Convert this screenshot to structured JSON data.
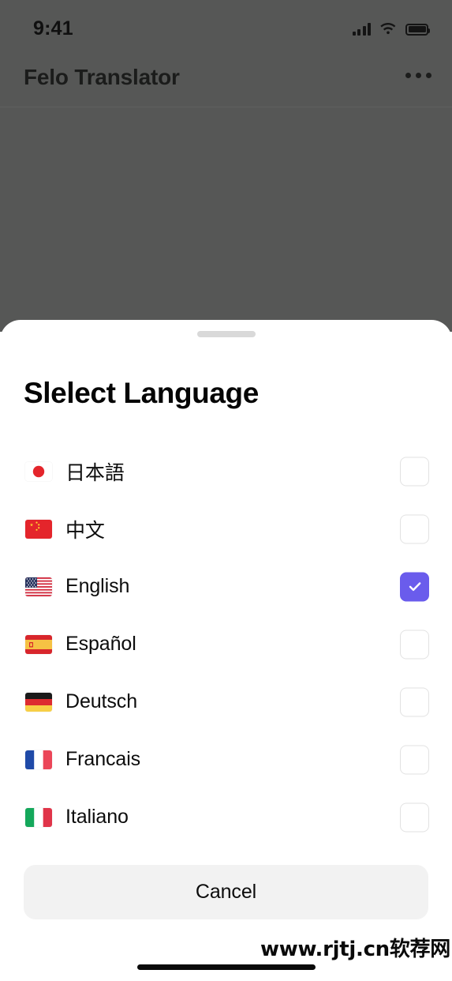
{
  "status_bar": {
    "time": "9:41",
    "icons": [
      "cellular-signal-icon",
      "wifi-icon",
      "battery-icon"
    ]
  },
  "app_bar": {
    "title": "Felo Translator",
    "overflow_icon": "more-horizontal-icon"
  },
  "sheet": {
    "handle": "drag-handle",
    "title": "Slelect Language",
    "cancel_label": "Cancel",
    "languages": [
      {
        "label": "日本語",
        "flag": "flag-japan",
        "checked": false
      },
      {
        "label": "中文",
        "flag": "flag-china",
        "checked": false
      },
      {
        "label": "English",
        "flag": "flag-usa",
        "checked": true
      },
      {
        "label": "Español",
        "flag": "flag-spain",
        "checked": false
      },
      {
        "label": "Deutsch",
        "flag": "flag-germany",
        "checked": false
      },
      {
        "label": "Francais",
        "flag": "flag-france",
        "checked": false
      },
      {
        "label": "Italiano",
        "flag": "flag-italy",
        "checked": false
      }
    ]
  },
  "watermark": {
    "text": "www.rjtj.cn软荐网"
  },
  "colors": {
    "accent": "#6A5CEC",
    "backdrop": "#565756",
    "sheet_bg": "#ffffff",
    "cancel_bg": "#F2F2F2",
    "checkbox_border": "#e2e2e2",
    "handle": "#d9d9d9"
  }
}
